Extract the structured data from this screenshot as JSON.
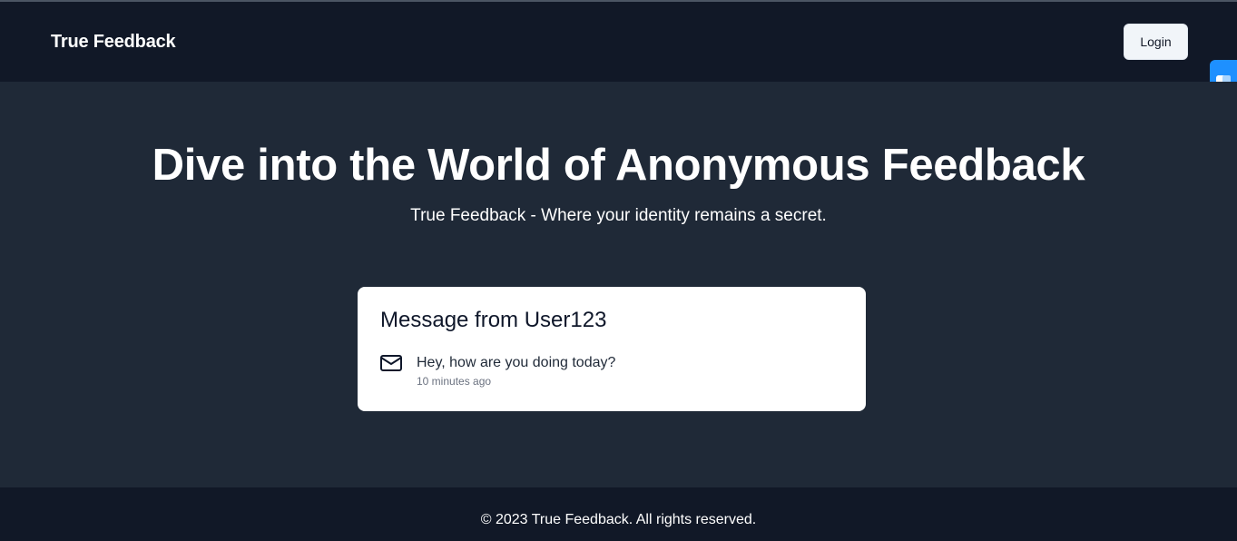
{
  "navbar": {
    "brand": "True Feedback",
    "login_label": "Login"
  },
  "hero": {
    "headline": "Dive into the World of Anonymous Feedback",
    "subheadline": "True Feedback - Where your identity remains a secret."
  },
  "message_card": {
    "title": "Message from User123",
    "icon": "mail-icon",
    "content": "Hey, how are you doing today?",
    "timestamp": "10 minutes ago"
  },
  "footer": {
    "copyright": "© 2023 True Feedback. All rights reserved."
  },
  "side_widget": {
    "icon": "extension-widget-icon",
    "color": "#1e90ff"
  },
  "colors": {
    "navbar_bg": "#111827",
    "hero_bg": "#1f2937",
    "card_bg": "#ffffff",
    "button_bg": "#f1f5f9"
  }
}
